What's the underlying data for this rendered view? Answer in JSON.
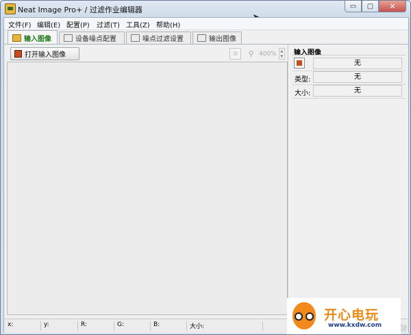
{
  "window": {
    "title": "Neat Image Pro+ / 过滤作业编辑器",
    "controls": {
      "minimize": "▭",
      "maximize": "▢",
      "close": "✕"
    }
  },
  "menu": [
    {
      "label": "文件(F)"
    },
    {
      "label": "编辑(E)"
    },
    {
      "label": "配置(P)"
    },
    {
      "label": "过滤(T)"
    },
    {
      "label": "工具(Z)"
    },
    {
      "label": "帮助(H)"
    }
  ],
  "tabs": [
    {
      "label": "输入图像",
      "active": true,
      "icon": "image-icon"
    },
    {
      "label": "设备噪点配置",
      "active": false,
      "icon": "camera-icon"
    },
    {
      "label": "噪点过滤设置",
      "active": false,
      "icon": "filter-settings-icon"
    },
    {
      "label": "输出图像",
      "active": false,
      "icon": "output-image-icon"
    }
  ],
  "toolbar": {
    "open_label": "打开输入图像",
    "zoom_value": "400%"
  },
  "panel": {
    "title": "输入图像",
    "file_value": "无",
    "type_label": "类型:",
    "type_value": "无",
    "size_label": "大小:",
    "size_value": "无"
  },
  "status": {
    "x": "x:",
    "y": "y:",
    "r": "R:",
    "g": "G:",
    "b": "B:",
    "size": "大小:"
  },
  "watermark": {
    "brand": "开心电玩",
    "url": "www.kxdw.com"
  },
  "colors": {
    "active_tab_text": "#1e7a1e",
    "close_button": "#c75050",
    "watermark_orange": "#e98a14",
    "watermark_blue": "#1f3f86"
  }
}
